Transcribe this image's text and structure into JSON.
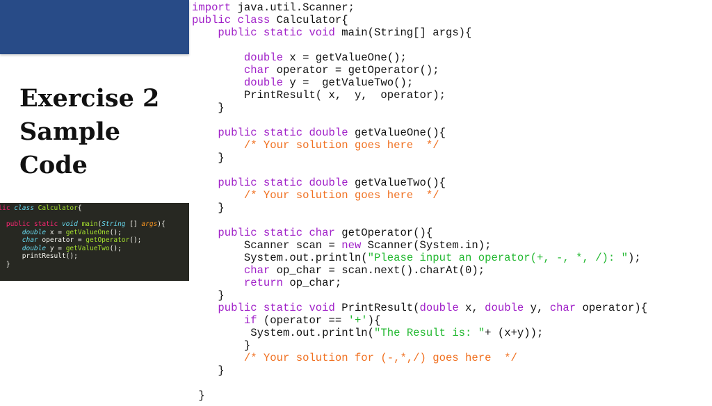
{
  "slide": {
    "title_lines": [
      "Exercise 2",
      "Sample",
      "Code"
    ],
    "accent_color": "#284b87"
  },
  "thumbnail": {
    "lines": [
      [
        {
          "t": "ublic ",
          "c": "kw"
        },
        {
          "t": "class ",
          "c": "type"
        },
        {
          "t": "Calculator",
          "c": "fn"
        },
        {
          "t": "{",
          "c": "plain"
        }
      ],
      [
        {
          "t": "",
          "c": "plain"
        }
      ],
      [
        {
          "t": "    public static ",
          "c": "kw"
        },
        {
          "t": "void ",
          "c": "type"
        },
        {
          "t": "main",
          "c": "fn"
        },
        {
          "t": "(",
          "c": "plain"
        },
        {
          "t": "String",
          "c": "type"
        },
        {
          "t": " [] ",
          "c": "plain"
        },
        {
          "t": "args",
          "c": "arg"
        },
        {
          "t": "){",
          "c": "plain"
        }
      ],
      [
        {
          "t": "        ",
          "c": "plain"
        },
        {
          "t": "double",
          "c": "type"
        },
        {
          "t": " x = ",
          "c": "plain"
        },
        {
          "t": "getValueOne",
          "c": "fn"
        },
        {
          "t": "();",
          "c": "plain"
        }
      ],
      [
        {
          "t": "        ",
          "c": "plain"
        },
        {
          "t": "char",
          "c": "type"
        },
        {
          "t": " operator = ",
          "c": "plain"
        },
        {
          "t": "getOperator",
          "c": "fn"
        },
        {
          "t": "();",
          "c": "plain"
        }
      ],
      [
        {
          "t": "        ",
          "c": "plain"
        },
        {
          "t": "double",
          "c": "type"
        },
        {
          "t": " y = ",
          "c": "plain"
        },
        {
          "t": "getValueTwo",
          "c": "fn"
        },
        {
          "t": "();",
          "c": "plain"
        }
      ],
      [
        {
          "t": "        printResult();",
          "c": "plain"
        }
      ],
      [
        {
          "t": "    }",
          "c": "plain"
        }
      ]
    ]
  },
  "code": {
    "lines": [
      [
        {
          "t": "import",
          "c": "k"
        },
        {
          "t": " java.util.Scanner;",
          "c": "p"
        }
      ],
      [
        {
          "t": "public class",
          "c": "k"
        },
        {
          "t": " Calculator{",
          "c": "p"
        }
      ],
      [
        {
          "t": "    public static void",
          "c": "k"
        },
        {
          "t": " main(String[] args){",
          "c": "p"
        }
      ],
      [
        {
          "t": "",
          "c": "p"
        }
      ],
      [
        {
          "t": "        double",
          "c": "k"
        },
        {
          "t": " x = getValueOne();",
          "c": "p"
        }
      ],
      [
        {
          "t": "        char",
          "c": "k"
        },
        {
          "t": " operator = getOperator();",
          "c": "p"
        }
      ],
      [
        {
          "t": "        double",
          "c": "k"
        },
        {
          "t": " y =  getValueTwo();",
          "c": "p"
        }
      ],
      [
        {
          "t": "        PrintResult( x,  y,  operator);",
          "c": "p"
        }
      ],
      [
        {
          "t": "    }",
          "c": "p"
        }
      ],
      [
        {
          "t": "",
          "c": "p"
        }
      ],
      [
        {
          "t": "    public static double",
          "c": "k"
        },
        {
          "t": " getValueOne(){",
          "c": "p"
        }
      ],
      [
        {
          "t": "        /* Your solution goes here  */",
          "c": "c"
        }
      ],
      [
        {
          "t": "    }",
          "c": "p"
        }
      ],
      [
        {
          "t": "",
          "c": "p"
        }
      ],
      [
        {
          "t": "    public static double",
          "c": "k"
        },
        {
          "t": " getValueTwo(){",
          "c": "p"
        }
      ],
      [
        {
          "t": "        /* Your solution goes here  */",
          "c": "c"
        }
      ],
      [
        {
          "t": "    }",
          "c": "p"
        }
      ],
      [
        {
          "t": "",
          "c": "p"
        }
      ],
      [
        {
          "t": "    public static char",
          "c": "k"
        },
        {
          "t": " getOperator(){",
          "c": "p"
        }
      ],
      [
        {
          "t": "        Scanner scan = ",
          "c": "p"
        },
        {
          "t": "new",
          "c": "k"
        },
        {
          "t": " Scanner(System.in);",
          "c": "p"
        }
      ],
      [
        {
          "t": "        System.out.println(",
          "c": "p"
        },
        {
          "t": "\"Please input an operator(+, -, *, /): \"",
          "c": "s"
        },
        {
          "t": ");",
          "c": "p"
        }
      ],
      [
        {
          "t": "        char",
          "c": "k"
        },
        {
          "t": " op_char = scan.next().charAt(0);",
          "c": "p"
        }
      ],
      [
        {
          "t": "        return",
          "c": "k"
        },
        {
          "t": " op_char;",
          "c": "p"
        }
      ],
      [
        {
          "t": "    }",
          "c": "p"
        }
      ],
      [
        {
          "t": "    public static void",
          "c": "k"
        },
        {
          "t": " PrintResult(",
          "c": "p"
        },
        {
          "t": "double",
          "c": "k"
        },
        {
          "t": " x, ",
          "c": "p"
        },
        {
          "t": "double",
          "c": "k"
        },
        {
          "t": " y, ",
          "c": "p"
        },
        {
          "t": "char",
          "c": "k"
        },
        {
          "t": " operator){",
          "c": "p"
        }
      ],
      [
        {
          "t": "        if",
          "c": "k"
        },
        {
          "t": " (operator == ",
          "c": "p"
        },
        {
          "t": "'+'",
          "c": "s"
        },
        {
          "t": "){",
          "c": "p"
        }
      ],
      [
        {
          "t": "         System.out.println(",
          "c": "p"
        },
        {
          "t": "\"The Result is: \"",
          "c": "s"
        },
        {
          "t": "+ (x+y));",
          "c": "p"
        }
      ],
      [
        {
          "t": "        }",
          "c": "p"
        }
      ],
      [
        {
          "t": "        /* Your solution for (-,*,/) goes here  */",
          "c": "c"
        }
      ],
      [
        {
          "t": "    }",
          "c": "p"
        }
      ],
      [
        {
          "t": "",
          "c": "p"
        }
      ],
      [
        {
          "t": " }",
          "c": "p"
        }
      ]
    ]
  }
}
